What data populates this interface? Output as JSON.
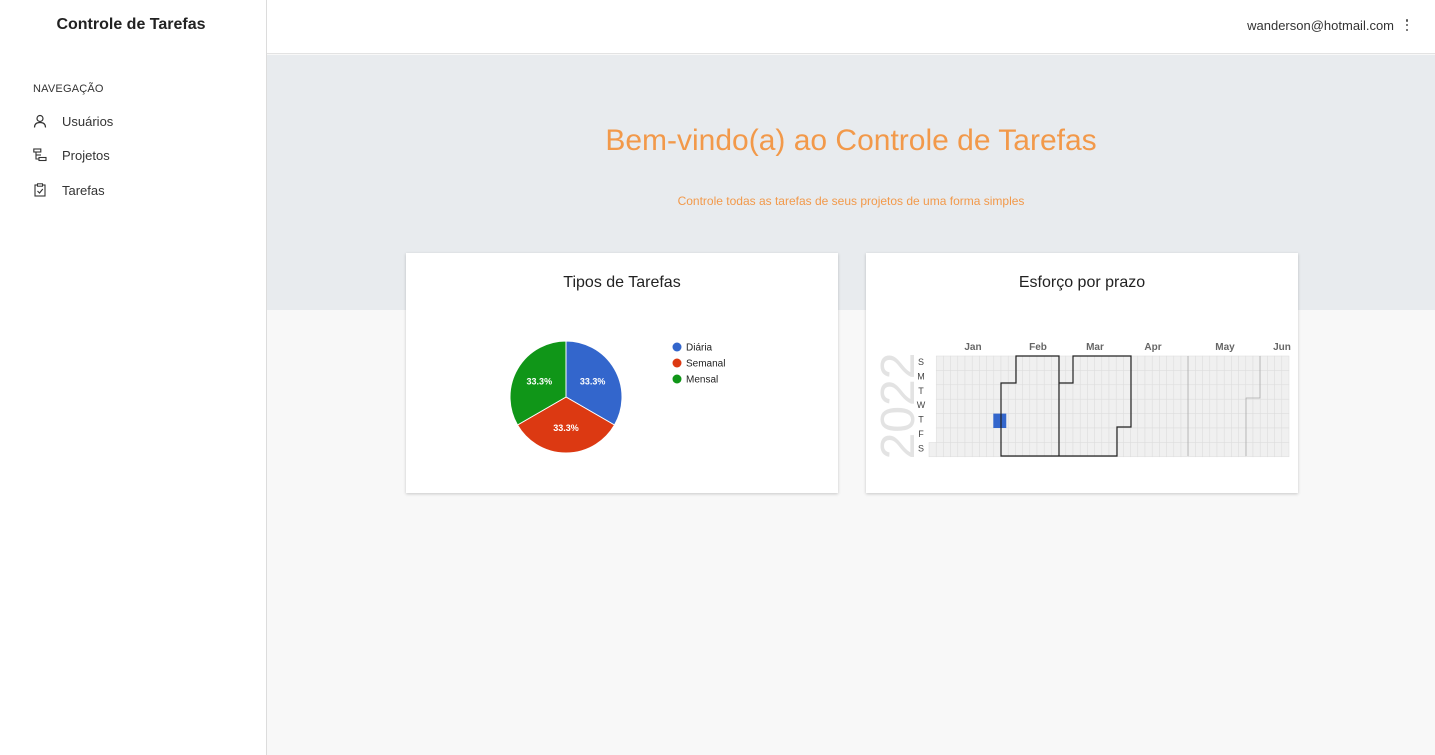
{
  "sidebar": {
    "brand": "Controle de Tarefas",
    "nav_heading": "NAVEGAÇÃO",
    "items": [
      {
        "label": "Usuários",
        "icon": "user-icon"
      },
      {
        "label": "Projetos",
        "icon": "project-tree-icon"
      },
      {
        "label": "Tarefas",
        "icon": "clipboard-check-icon"
      }
    ]
  },
  "topbar": {
    "user_email": "wanderson@hotmail.com",
    "menu_icon": "kebab-menu-icon"
  },
  "hero": {
    "title": "Bem-vindo(a) ao Controle de Tarefas",
    "subtitle": "Controle todas as tarefas de seus projetos de uma forma simples"
  },
  "colors": {
    "accent": "#f2994a",
    "hero_bg": "#e8ebee",
    "diaria": "#3366cc",
    "semanal": "#dc3912",
    "mensal": "#109618"
  },
  "chart_data": [
    {
      "type": "pie",
      "title": "Tipos de Tarefas",
      "categories": [
        "Diária",
        "Semanal",
        "Mensal"
      ],
      "values": [
        1,
        1,
        1
      ],
      "slice_labels": [
        "33.3%",
        "33.3%",
        "33.3%"
      ],
      "colors": [
        "#3366cc",
        "#dc3912",
        "#109618"
      ],
      "legend": "right"
    },
    {
      "type": "heatmap",
      "title": "Esforço por prazo",
      "year": "2022",
      "months": [
        "Jan",
        "Feb",
        "Mar",
        "Apr",
        "May",
        "Jun"
      ],
      "weekdays": [
        "S",
        "M",
        "T",
        "W",
        "T",
        "F",
        "S"
      ],
      "highlight": {
        "week": 9,
        "day": 4,
        "color": "#3366cc"
      }
    }
  ]
}
